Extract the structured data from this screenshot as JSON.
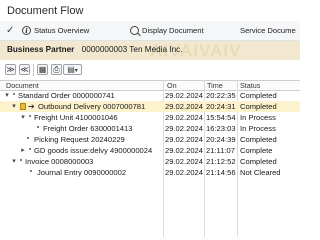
{
  "window": {
    "title": "Document Flow"
  },
  "toolbar": {
    "status_overview": "Status Overview",
    "display_document": "Display Document",
    "service_documents": "Service Docume"
  },
  "business_partner": {
    "label": "Business Partner",
    "value": "0000000003 Ten Media Inc.",
    "watermark": "AIVAIVAIV"
  },
  "columns": {
    "document": "Document",
    "on": "On",
    "time": "Time",
    "status": "Status"
  },
  "rows": [
    {
      "document": "Standard Order 0000000741",
      "on": "29.02.2024",
      "time": "20:22:35",
      "status": "Completed"
    },
    {
      "document": "Outbound Delivery 0007000781",
      "on": "29.02.2024",
      "time": "20:24:31",
      "status": "Completed"
    },
    {
      "document": "Freight Unit 4100001046",
      "on": "29.02.2024",
      "time": "15:54:54",
      "status": "In Process"
    },
    {
      "document": "Freight Order 6300001413",
      "on": "29.02.2024",
      "time": "16:23:03",
      "status": "In Process"
    },
    {
      "document": "Picking Request 20240229",
      "on": "29.02.2024",
      "time": "20:24:39",
      "status": "Completed"
    },
    {
      "document": "GD goods issue:delvy 4900000024",
      "on": "29.02.2024",
      "time": "21:11:07",
      "status": "Complete"
    },
    {
      "document": "Invoice 0008000003",
      "on": "29.02.2024",
      "time": "21:12:52",
      "status": "Completed"
    },
    {
      "document": "Journal Entry 0090000002",
      "on": "29.02.2024",
      "time": "21:14:56",
      "status": "Not Cleared"
    }
  ]
}
